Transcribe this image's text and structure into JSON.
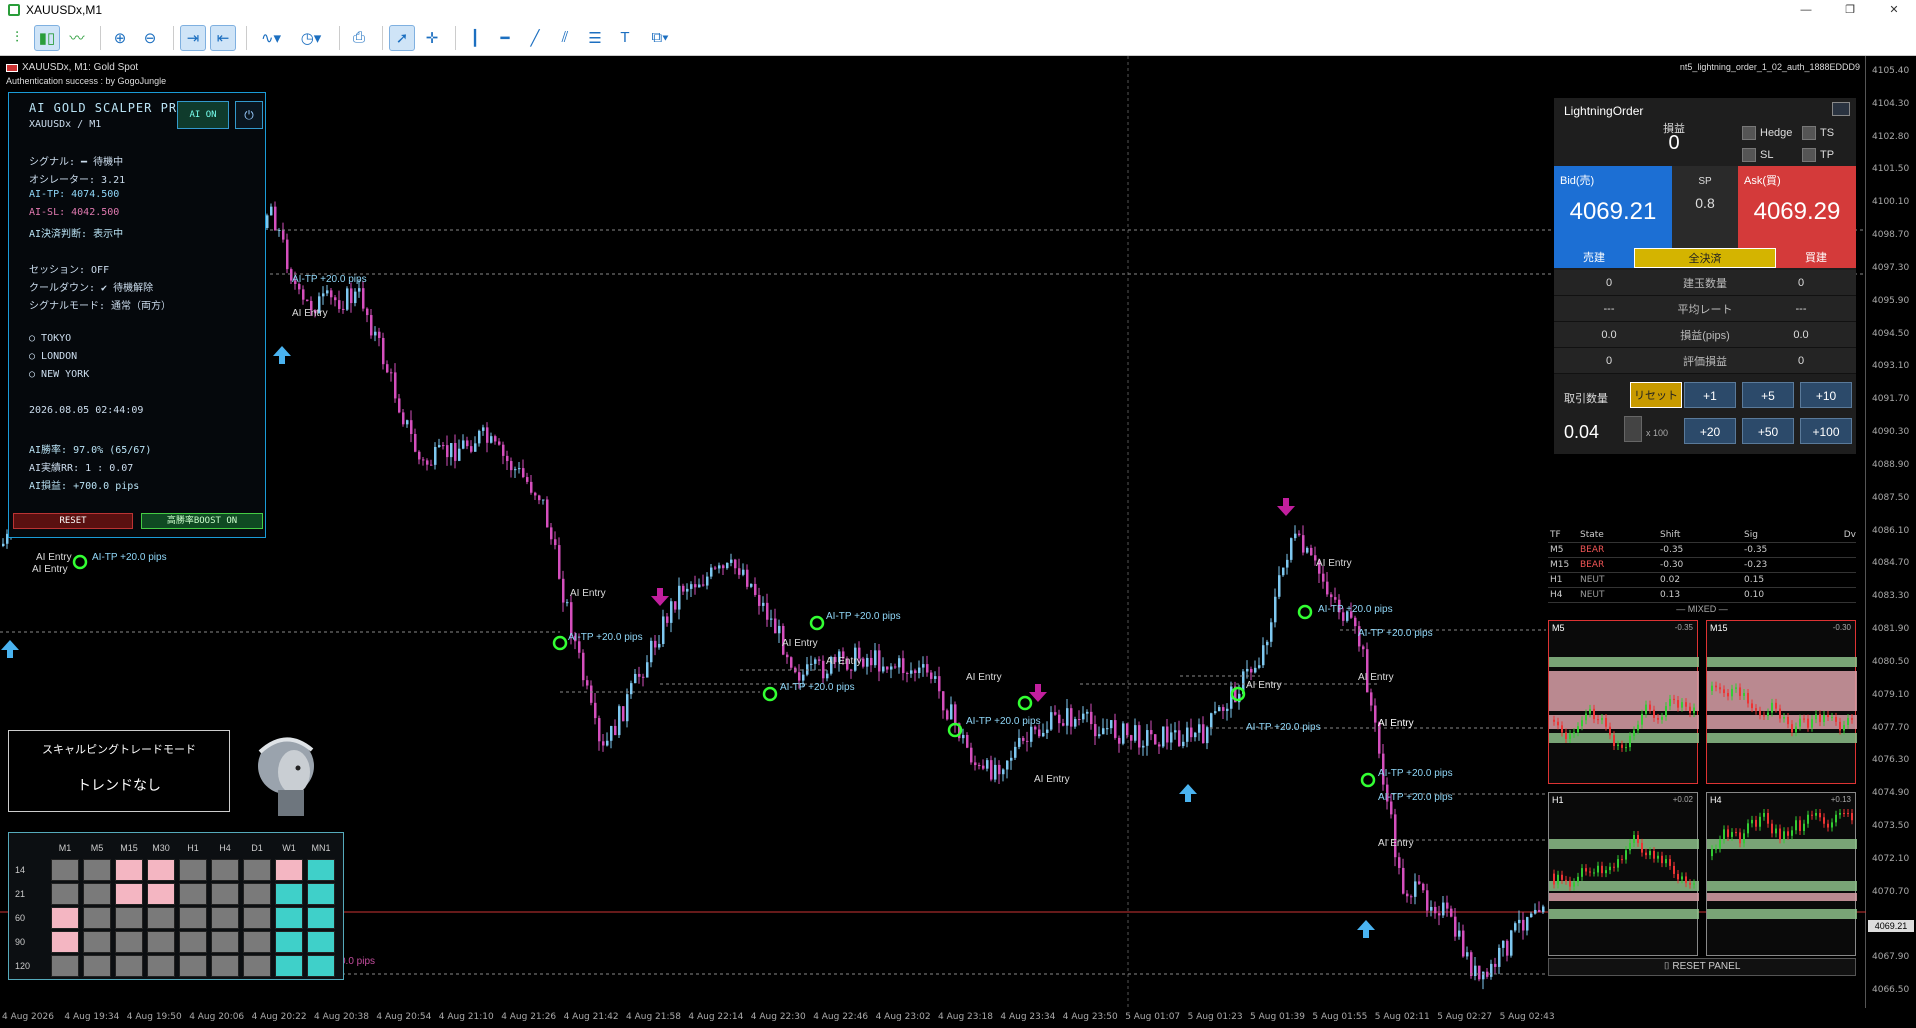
{
  "window": {
    "title": "XAUUSDx,M1",
    "btn_min": "—",
    "btn_max": "❐",
    "btn_close": "✕"
  },
  "toolbar": {
    "icons": [
      "bar-chart-icon",
      "candle-chart-icon",
      "line-chart-icon",
      "zoom-in-icon",
      "zoom-out-icon",
      "autoscroll-icon",
      "chart-shift-icon",
      "indicators-icon",
      "timeframes-icon",
      "screenshot-icon",
      "cursor-icon",
      "crosshair-icon",
      "vertical-line-icon",
      "horizontal-line-icon",
      "trendline-icon",
      "channel-icon",
      "fibo-icon",
      "text-icon",
      "shapes-icon"
    ]
  },
  "chart": {
    "symbol_line": "XAUUSDx, M1:  Gold Spot",
    "auth": "Authentication success : by GogoJungle",
    "ea_name": "nt5_lightning_order_1_02_auth_1888EDDD9",
    "price_labels": [
      "4105.40",
      "4104.30",
      "4102.80",
      "4101.50",
      "4100.10",
      "4098.70",
      "4097.30",
      "4095.90",
      "4094.50",
      "4093.10",
      "4091.70",
      "4090.30",
      "4088.90",
      "4087.50",
      "4086.10",
      "4084.70",
      "4083.30",
      "4081.90",
      "4080.50",
      "4079.10",
      "4077.70",
      "4076.30",
      "4074.90",
      "4073.50",
      "4072.10",
      "4070.70",
      "4069.21",
      "4067.90",
      "4066.50"
    ],
    "current_price": "4069.21",
    "time_labels": [
      "4 Aug 2026",
      "4 Aug 19:34",
      "4 Aug 19:50",
      "4 Aug 20:06",
      "4 Aug 20:22",
      "4 Aug 20:38",
      "4 Aug 20:54",
      "4 Aug 21:10",
      "4 Aug 21:26",
      "4 Aug 21:42",
      "4 Aug 21:58",
      "4 Aug 22:14",
      "4 Aug 22:30",
      "4 Aug 22:46",
      "4 Aug 23:02",
      "4 Aug 23:18",
      "4 Aug 23:34",
      "4 Aug 23:50",
      "5 Aug 01:07",
      "5 Aug 01:23",
      "5 Aug 01:39",
      "5 Aug 01:55",
      "5 Aug 02:11",
      "5 Aug 02:27",
      "5 Aug 02:43"
    ],
    "annotations": {
      "ai_entry": "AI Entry",
      "ai_tp": "AI-TP  +20.0 pips",
      "ai_tp_short": "AI-TP +20.0 pips",
      "pips": "0.0 pips"
    }
  },
  "ai_panel": {
    "title": "AI GOLD SCALPER PRO",
    "symbol": "XAUUSDx / M1",
    "ai_on": "AI ON",
    "power": "⏻",
    "signal": "シグナル: ━ 待機中",
    "oscillator": "オシレーター: 3.21",
    "ai_tp": "AI-TP: 4074.500",
    "ai_sl": "AI-SL: 4042.500",
    "ai_decision": "AI決済判断: 表示中",
    "session": "セッション: OFF",
    "cooldown": "クールダウン: ✔ 待機解除",
    "signal_mode": "シグナルモード: 通常（両方）",
    "sessions": [
      "TOKYO",
      "LONDON",
      "NEW YORK"
    ],
    "datetime": "2026.08.05 02:44:09",
    "winrate": "AI勝率: 97.0% (65/67)",
    "rr": "AI実績RR: 1 : 0.07",
    "profit": "AI損益: +700.0 pips",
    "reset": "RESET",
    "boost": "高勝率BOOST ON"
  },
  "mode_box": {
    "title": "スキャルピングトレードモード",
    "value": "トレンドなし"
  },
  "heat_grid": {
    "cols": [
      "M1",
      "M5",
      "M15",
      "M30",
      "H1",
      "H4",
      "D1",
      "W1",
      "MN1"
    ],
    "rows": [
      "14",
      "21",
      "60",
      "90",
      "120"
    ],
    "cells": [
      [
        "g",
        "g",
        "p",
        "p",
        "g",
        "g",
        "g",
        "p",
        "c"
      ],
      [
        "g",
        "g",
        "p",
        "p",
        "g",
        "g",
        "g",
        "c",
        "c"
      ],
      [
        "p",
        "g",
        "g",
        "g",
        "g",
        "g",
        "g",
        "c",
        "c"
      ],
      [
        "p",
        "g",
        "g",
        "g",
        "g",
        "g",
        "g",
        "c",
        "c"
      ],
      [
        "g",
        "g",
        "g",
        "g",
        "g",
        "g",
        "g",
        "c",
        "c"
      ]
    ],
    "colors": {
      "g": "#7a7a7a",
      "p": "#f4b6c2",
      "c": "#3fd0c9"
    }
  },
  "lightning": {
    "title": "LightningOrder",
    "pl_label": "損益",
    "pl_value": "0",
    "hedge": "Hedge",
    "ts": "TS",
    "sl": "SL",
    "tp": "TP",
    "bid_label": "Bid(売)",
    "bid": "4069.21",
    "sp_label": "SP",
    "sp": "0.8",
    "ask_label": "Ask(買)",
    "ask": "4069.29",
    "sell": "売建",
    "close_all": "全決済",
    "buy": "買建",
    "rows": [
      {
        "v1": "0",
        "label": "建玉数量",
        "v2": "0"
      },
      {
        "v1": "---",
        "label": "平均レート",
        "v2": "---"
      },
      {
        "v1": "0.0",
        "label": "損益(pips)",
        "v2": "0.0"
      },
      {
        "v1": "0",
        "label": "評価損益",
        "v2": "0"
      }
    ],
    "qty_label": "取引数量",
    "reset": "リセット",
    "btns_row1": [
      "+1",
      "+5",
      "+10"
    ],
    "btns_row2": [
      "+20",
      "+50",
      "+100"
    ],
    "qty": "0.04",
    "multiplier": "x 100"
  },
  "tf_table": {
    "headers": [
      "TF",
      "State",
      "Shift",
      "Sig",
      "Dv"
    ],
    "rows": [
      [
        "M5",
        "BEAR",
        "-0.35",
        "-0.35",
        ""
      ],
      [
        "M15",
        "BEAR",
        "-0.30",
        "-0.23",
        ""
      ],
      [
        "H1",
        "NEUT",
        "0.02",
        "0.15",
        ""
      ],
      [
        "H4",
        "NEUT",
        "0.13",
        "0.10",
        ""
      ]
    ],
    "mixed": "— MIXED —",
    "mini": [
      {
        "tf": "M5",
        "val": "-0.35"
      },
      {
        "tf": "M15",
        "val": "-0.30"
      },
      {
        "tf": "H1",
        "val": "+0.02"
      },
      {
        "tf": "H4",
        "val": "+0.13"
      }
    ],
    "reset_panel": "⌷  RESET PANEL"
  }
}
